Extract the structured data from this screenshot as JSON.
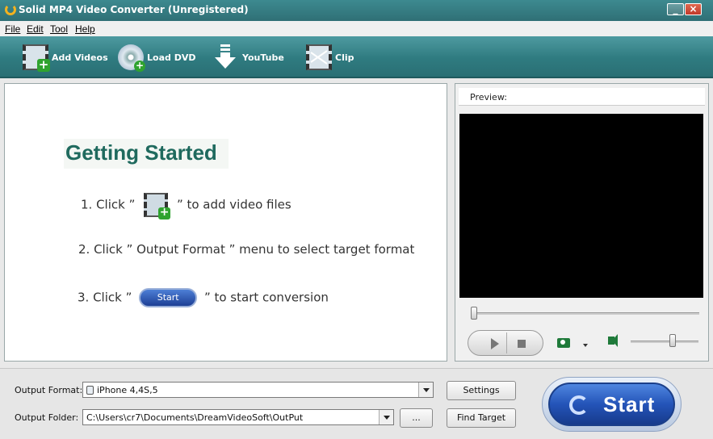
{
  "window": {
    "title": "Solid MP4 Video Converter (Unregistered)"
  },
  "menu": [
    "File",
    "Edit",
    "Tool",
    "Help"
  ],
  "toolbar": [
    {
      "label": "Add Videos",
      "icon": "film-add-icon"
    },
    {
      "label": "Load DVD",
      "icon": "dvd-add-icon"
    },
    {
      "label": "YouTube",
      "icon": "download-arrow-icon"
    },
    {
      "label": "Clip",
      "icon": "clip-film-icon"
    }
  ],
  "guide": {
    "title": "Getting Started",
    "step1": {
      "prefix": "1. Click ”",
      "suffix": "” to add video files"
    },
    "step2": {
      "text": "2. Click ”  Output Format ” menu to select  target format"
    },
    "step3": {
      "prefix": "3. Click ”",
      "suffix": "” to start conversion",
      "button": "Start"
    }
  },
  "preview": {
    "label": "Preview:"
  },
  "output": {
    "format_label": "Output Format:",
    "format_value": "iPhone 4,4S,5",
    "folder_label": "Output Folder:",
    "folder_value": "C:\\Users\\cr7\\Documents\\DreamVideoSoft\\OutPut",
    "browse_label": "...",
    "settings_label": "Settings",
    "find_target_label": "Find Target"
  },
  "start": {
    "label": "Start"
  },
  "colors": {
    "accent": "#2f7b80",
    "title_green": "#1f6a5e",
    "start_blue": "#2454b8"
  }
}
